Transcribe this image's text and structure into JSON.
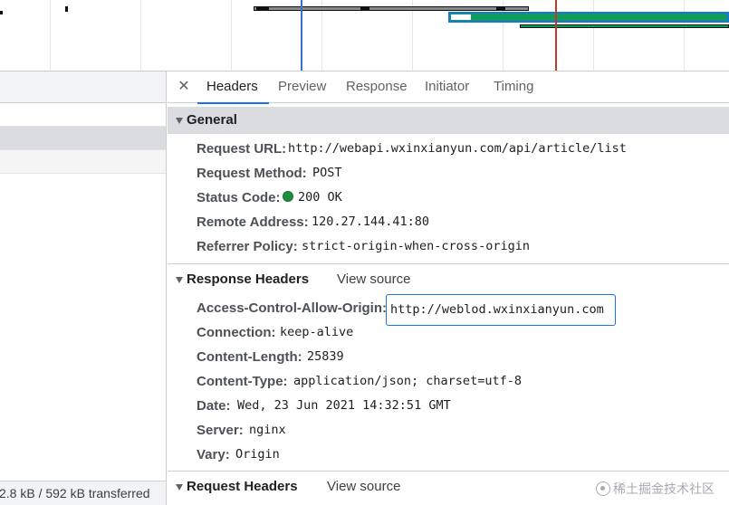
{
  "tabs": {
    "close_glyph": "✕",
    "items": [
      {
        "label": "Headers"
      },
      {
        "label": "Preview"
      },
      {
        "label": "Response"
      },
      {
        "label": "Initiator"
      },
      {
        "label": "Timing"
      }
    ],
    "active": "Headers"
  },
  "general": {
    "title": "General",
    "rows": [
      {
        "key": "Request URL:",
        "value": "http://webapi.wxinxianyun.com/api/article/list"
      },
      {
        "key": "Request Method:",
        "value": "POST"
      },
      {
        "key": "Status Code:",
        "value": "200 OK",
        "status_color": "#1e8e3e"
      },
      {
        "key": "Remote Address:",
        "value": "120.27.144.41:80"
      },
      {
        "key": "Referrer Policy:",
        "value": "strict-origin-when-cross-origin"
      }
    ]
  },
  "response_headers": {
    "title": "Response Headers",
    "view_source": "View source",
    "rows": [
      {
        "key": "Access-Control-Allow-Origin:",
        "value": "http://weblod.wxinxianyun.com",
        "highlighted": true
      },
      {
        "key": "Connection:",
        "value": "keep-alive"
      },
      {
        "key": "Content-Length:",
        "value": "25839"
      },
      {
        "key": "Content-Type:",
        "value": "application/json; charset=utf-8"
      },
      {
        "key": "Date:",
        "value": "Wed, 23 Jun 2021 14:32:51 GMT"
      },
      {
        "key": "Server:",
        "value": "nginx"
      },
      {
        "key": "Vary:",
        "value": "Origin"
      }
    ]
  },
  "request_headers": {
    "title": "Request Headers",
    "view_source": "View source"
  },
  "status_bar": {
    "text": "2.8 kB / 592 kB transferred"
  },
  "watermark": {
    "text": "稀土掘金技术社区"
  },
  "colors": {
    "accent": "#1a73e8",
    "waterfall_green": "#0f9d58",
    "waterfall_blue": "#1a73e8",
    "dom_content_loaded_line": "#3b6fd8",
    "load_line": "#c0392b"
  }
}
